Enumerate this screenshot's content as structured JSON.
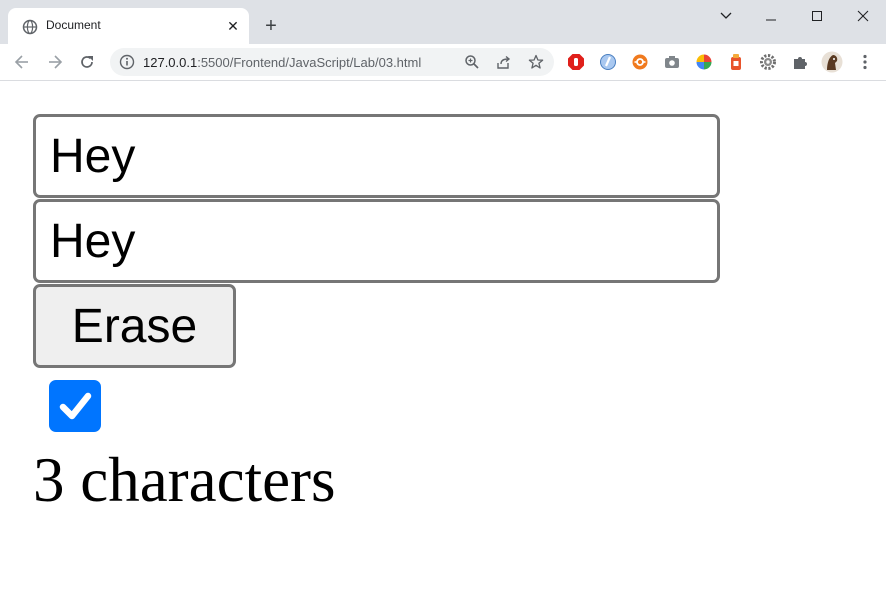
{
  "browser": {
    "tab": {
      "title": "Document",
      "close_glyph": "✕"
    },
    "new_tab_glyph": "+",
    "address": {
      "host": "127.0.0.1",
      "rest": ":5500/Frontend/JavaScript/Lab/03.html"
    },
    "icons": {
      "back": "arrow-left-icon",
      "forward": "arrow-right-icon",
      "reload": "reload-icon",
      "info": "info-icon",
      "zoom": "zoom-icon",
      "share": "share-icon",
      "bookmark": "star-icon",
      "extensions": [
        "adblock-icon",
        "extension-blue-icon",
        "extension-orange-icon",
        "camera-icon",
        "color-wheel-icon",
        "extension-red-icon",
        "gear-extension-icon",
        "puzzle-icon"
      ],
      "profile": "avatar",
      "menu": "more-vert-icon"
    }
  },
  "page": {
    "input1_value": "Hey",
    "input2_value": "Hey",
    "erase_label": "Erase",
    "checkbox_checked": true,
    "count_text": "3 characters"
  },
  "colors": {
    "checkbox": "#0075ff",
    "border": "#767676",
    "button_bg": "#efefef"
  }
}
